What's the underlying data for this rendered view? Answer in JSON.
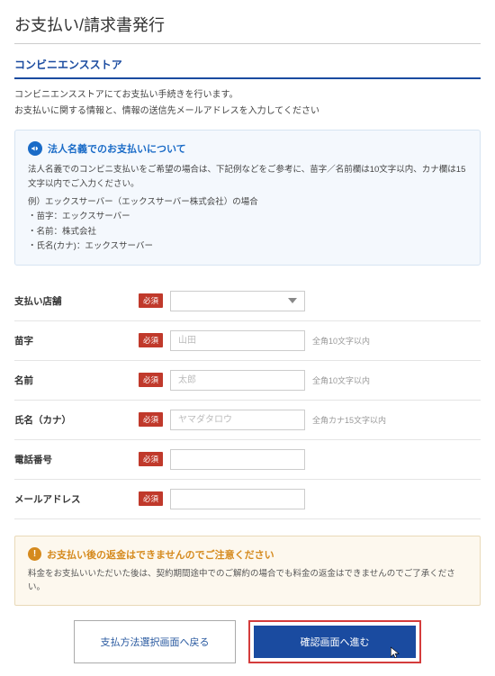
{
  "page_title": "お支払い/請求書発行",
  "section_title": "コンビニエンスストア",
  "intro": {
    "line1": "コンビニエンスストアにてお支払い手続きを行います。",
    "line2": "お支払いに関する情報と、情報の送信先メールアドレスを入力してください"
  },
  "corp_notice": {
    "title": "法人名義でのお支払いについて",
    "body1": "法人名義でのコンビニ支払いをご希望の場合は、下記例などをご参考に、苗字／名前欄は10文字以内、カナ欄は15文字以内でご入力ください。",
    "ex_head": "例）エックスサーバー（エックスサーバー株式会社）の場合",
    "ex1": "・苗字：エックスサーバー",
    "ex2": "・名前：株式会社",
    "ex3": "・氏名(カナ)：エックスサーバー"
  },
  "required_label": "必須",
  "fields": {
    "store": {
      "label": "支払い店舗",
      "value": ""
    },
    "lastname": {
      "label": "苗字",
      "placeholder": "山田",
      "value": "",
      "hint": "全角10文字以内"
    },
    "firstname": {
      "label": "名前",
      "placeholder": "太郎",
      "value": "",
      "hint": "全角10文字以内"
    },
    "kana": {
      "label": "氏名（カナ）",
      "placeholder": "ヤマダタロウ",
      "value": "",
      "hint": "全角カナ15文字以内"
    },
    "tel": {
      "label": "電話番号",
      "value": ""
    },
    "email": {
      "label": "メールアドレス",
      "value": ""
    }
  },
  "refund_warn": {
    "title": "お支払い後の返金はできませんのでご注意ください",
    "body": "料金をお支払いいただいた後は、契約期間途中でのご解約の場合でも料金の返金はできませんのでご了承ください。"
  },
  "buttons": {
    "back": "支払方法選択画面へ戻る",
    "next": "確認画面へ進む"
  }
}
